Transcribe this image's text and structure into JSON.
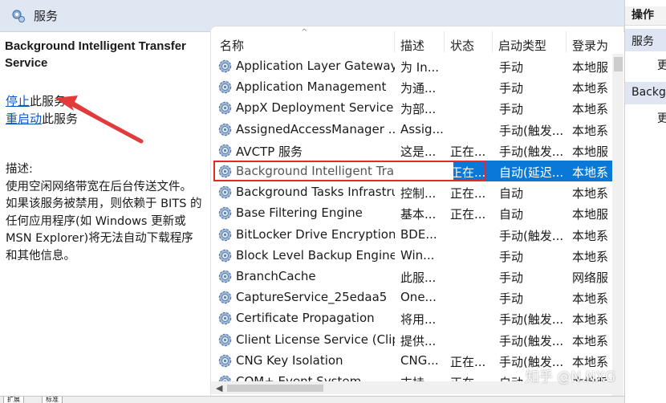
{
  "window": {
    "title": "服务",
    "icon": "services-icon"
  },
  "description_pane": {
    "service_title": "Background Intelligent Transfer Service",
    "stop_link": "停止",
    "stop_suffix": "此服务",
    "restart_link": "重启动",
    "restart_suffix": "此服务",
    "desc_label": "描述:",
    "desc_lines": [
      "使用空闲网络带宽在后台传送文件。",
      "如果该服务被禁用，则依赖于 BITS 的",
      "任何应用程序(如 Windows 更新或",
      "MSN Explorer)将无法自动下载程序",
      "和其他信息。"
    ]
  },
  "list": {
    "columns": {
      "name": "名称",
      "description": "描述",
      "status": "状态",
      "startup": "启动类型",
      "logon": "登录为"
    },
    "sort_indicator": "^",
    "rows": [
      {
        "name": "Application Layer Gateway ...",
        "description": "为 In...",
        "status": "",
        "startup": "手动",
        "logon": "本地服"
      },
      {
        "name": "Application Management",
        "description": "为通...",
        "status": "",
        "startup": "手动",
        "logon": "本地系"
      },
      {
        "name": "AppX Deployment Service ...",
        "description": "为部...",
        "status": "",
        "startup": "手动",
        "logon": "本地系"
      },
      {
        "name": "AssignedAccessManager ...",
        "description": "Assig...",
        "status": "",
        "startup": "手动(触发...",
        "logon": "本地系"
      },
      {
        "name": "AVCTP 服务",
        "description": "这是...",
        "status": "正在...",
        "startup": "手动(触发...",
        "logon": "本地服"
      },
      {
        "name": "Background Intelligent Transfer Service",
        "description": "",
        "status": "正在...",
        "startup": "自动(延迟...",
        "logon": "本地系",
        "selected": true
      },
      {
        "name": "Background Tasks Infrastru...",
        "description": "控制...",
        "status": "正在...",
        "startup": "自动",
        "logon": "本地系"
      },
      {
        "name": "Base Filtering Engine",
        "description": "基本...",
        "status": "正在...",
        "startup": "自动",
        "logon": "本地服"
      },
      {
        "name": "BitLocker Drive Encryption ...",
        "description": "BDE...",
        "status": "",
        "startup": "手动(触发...",
        "logon": "本地系"
      },
      {
        "name": "Block Level Backup Engine ...",
        "description": "Win...",
        "status": "",
        "startup": "手动",
        "logon": "本地系"
      },
      {
        "name": "BranchCache",
        "description": "此服...",
        "status": "",
        "startup": "手动",
        "logon": "网络服"
      },
      {
        "name": "CaptureService_25edaa5",
        "description": "One...",
        "status": "",
        "startup": "手动",
        "logon": "本地系"
      },
      {
        "name": "Certificate Propagation",
        "description": "将用...",
        "status": "",
        "startup": "手动(触发...",
        "logon": "本地系"
      },
      {
        "name": "Client License Service (Clip...",
        "description": "提供...",
        "status": "",
        "startup": "手动(触发...",
        "logon": "本地系"
      },
      {
        "name": "CNG Key Isolation",
        "description": "CNG...",
        "status": "正在...",
        "startup": "手动(触发...",
        "logon": "本地系"
      },
      {
        "name": "COM+ Event System",
        "description": "支持...",
        "status": "正在...",
        "startup": "自动",
        "logon": "本地服"
      }
    ]
  },
  "actions": {
    "header": "操作",
    "groups": [
      {
        "label": "服务",
        "more": "更"
      },
      {
        "label": "Backgr",
        "more": "更"
      }
    ]
  },
  "bottom_tabs": [
    "扩展",
    "标准"
  ],
  "watermark": "知乎 @N.NXG",
  "colors": {
    "selection": "#0a78d7",
    "highlight_box": "#e22a2a",
    "link": "#0b57c2",
    "arrow": "#e23b3b"
  }
}
